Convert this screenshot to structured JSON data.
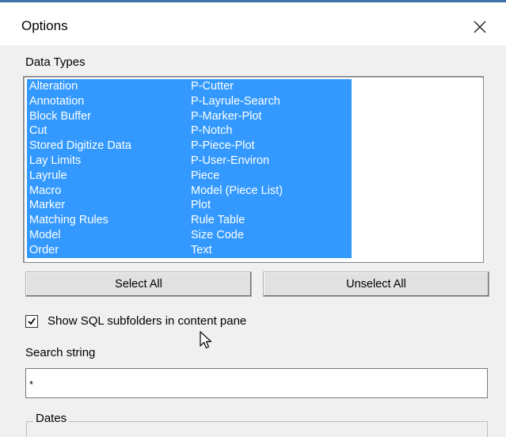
{
  "dialog": {
    "title": "Options",
    "close_icon": "close-icon"
  },
  "data_types": {
    "label": "Data Types",
    "items_col1": [
      "Alteration",
      "Annotation",
      "Block Buffer",
      "Cut",
      "Stored Digitize Data",
      "Lay Limits",
      "Layrule",
      "Macro",
      "Marker",
      "Matching Rules",
      "Model",
      "Order"
    ],
    "items_col2": [
      "P-Cutter",
      "P-Layrule-Search",
      "P-Marker-Plot",
      "P-Notch",
      "P-Piece-Plot",
      "P-User-Environ",
      "Piece",
      "Model (Piece List)",
      "Plot",
      "Rule Table",
      "Size Code",
      "Text"
    ],
    "selected_color": "#3399ff"
  },
  "buttons": {
    "select_all": "Select All",
    "unselect_all": "Unselect All"
  },
  "checkbox": {
    "label": "Show SQL subfolders in content pane",
    "checked": true
  },
  "search": {
    "label": "Search string",
    "value": "*"
  },
  "dates": {
    "label": "Dates"
  }
}
